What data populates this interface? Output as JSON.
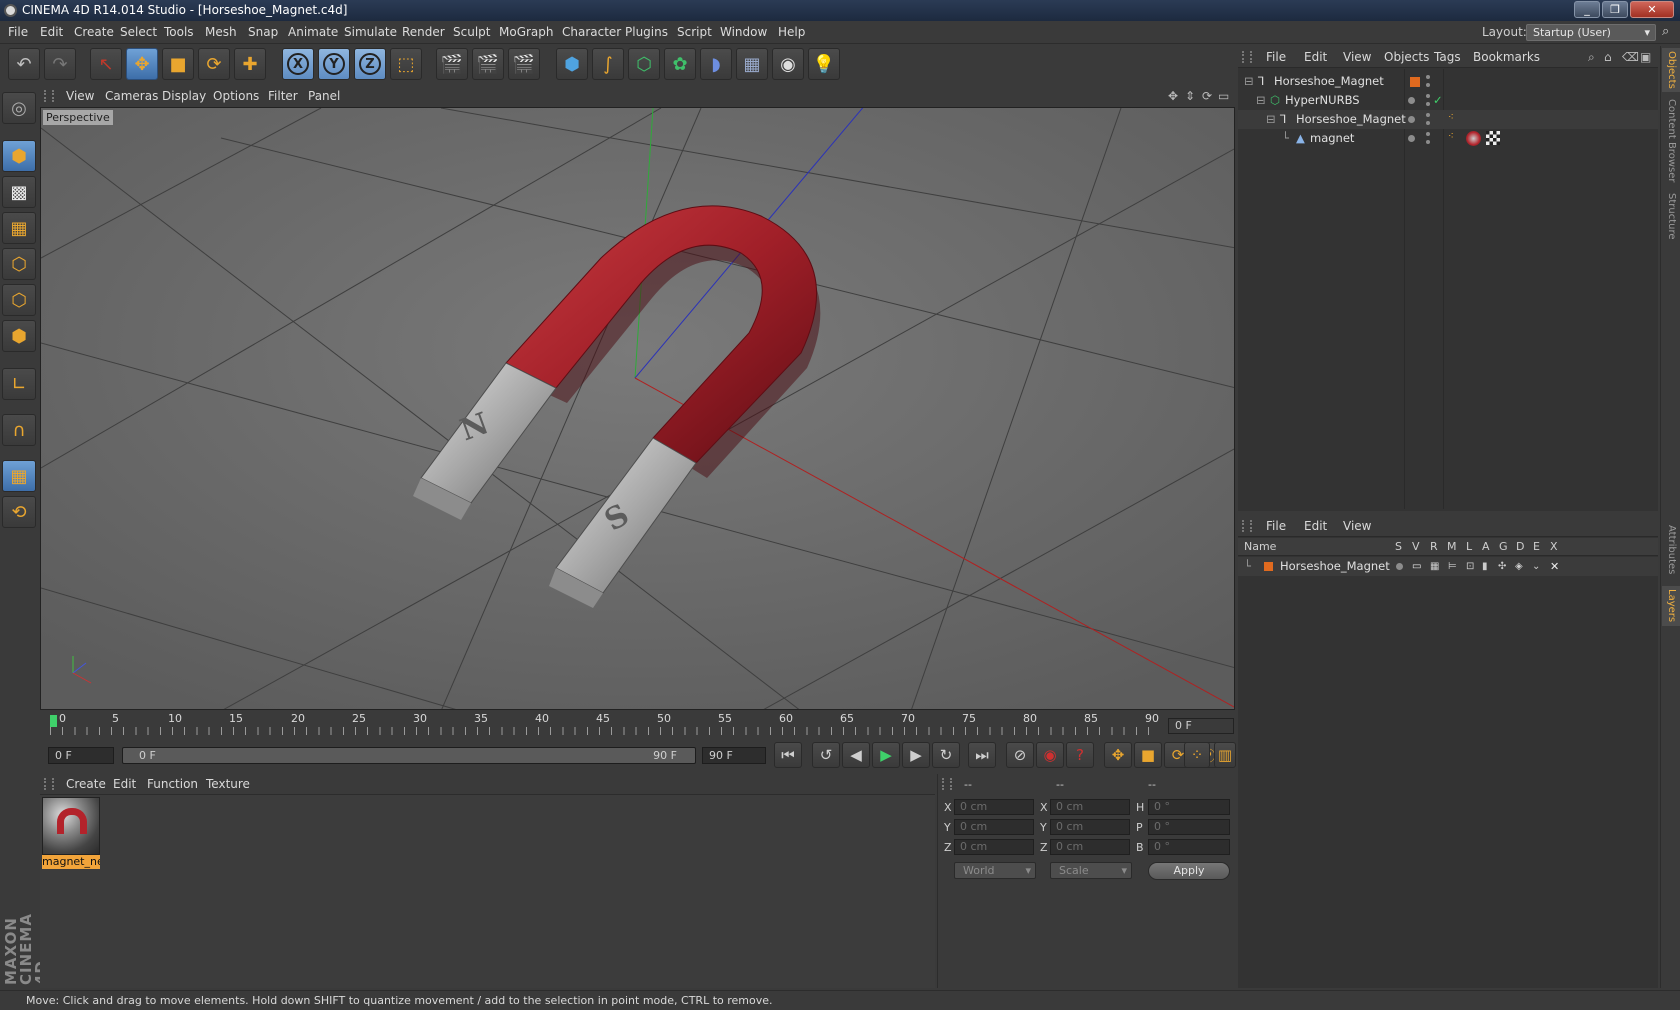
{
  "window": {
    "title": "CINEMA 4D R14.014 Studio - [Horseshoe_Magnet.c4d]",
    "min": "_",
    "max": "❐",
    "close": "✕"
  },
  "menubar": [
    "File",
    "Edit",
    "Create",
    "Select",
    "Tools",
    "Mesh",
    "Snap",
    "Animate",
    "Simulate",
    "Render",
    "Sculpt",
    "MoGraph",
    "Character",
    "Plugins",
    "Script",
    "Window",
    "Help"
  ],
  "layout": {
    "label": "Layout:",
    "value": "Startup (User)"
  },
  "toolbar": {
    "axis_x": "X",
    "axis_y": "Y",
    "axis_z": "Z"
  },
  "viewport": {
    "menu": [
      "View",
      "Cameras",
      "Display",
      "Options",
      "Filter",
      "Panel"
    ],
    "label": "Perspective",
    "magnet_n": "N",
    "magnet_s": "S"
  },
  "timeline": {
    "ticks": [
      "0",
      "5",
      "10",
      "15",
      "20",
      "25",
      "30",
      "35",
      "40",
      "45",
      "50",
      "55",
      "60",
      "65",
      "70",
      "75",
      "80",
      "85",
      "90"
    ],
    "current": "0 F"
  },
  "transport": {
    "start": "0 F",
    "range_start": "0 F",
    "range_end": "90 F",
    "end": "90 F"
  },
  "material_manager": {
    "menu": [
      "Create",
      "Edit",
      "Function",
      "Texture"
    ],
    "material_name": "magnet_ne"
  },
  "coordinates": {
    "header": [
      "--",
      "--",
      "--"
    ],
    "pos": [
      {
        "axis": "X",
        "value": "0 cm"
      },
      {
        "axis": "Y",
        "value": "0 cm"
      },
      {
        "axis": "Z",
        "value": "0 cm"
      }
    ],
    "size": [
      {
        "axis": "X",
        "value": "0 cm"
      },
      {
        "axis": "Y",
        "value": "0 cm"
      },
      {
        "axis": "Z",
        "value": "0 cm"
      }
    ],
    "rot": [
      {
        "axis": "H",
        "value": "0 °"
      },
      {
        "axis": "P",
        "value": "0 °"
      },
      {
        "axis": "B",
        "value": "0 °"
      }
    ],
    "mode": "World",
    "size_mode": "Scale",
    "apply": "Apply"
  },
  "object_manager": {
    "menu": [
      "File",
      "Edit",
      "View",
      "Objects",
      "Tags",
      "Bookmarks"
    ],
    "objects": [
      {
        "name": "Horseshoe_Magnet"
      },
      {
        "name": "HyperNURBS"
      },
      {
        "name": "Horseshoe_Magnet"
      },
      {
        "name": "magnet"
      }
    ]
  },
  "attribute_manager": {
    "menu": [
      "File",
      "Edit",
      "View"
    ],
    "columns": [
      "Name",
      "S",
      "V",
      "R",
      "M",
      "L",
      "A",
      "G",
      "D",
      "E",
      "X"
    ],
    "layer_name": "Horseshoe_Magnet"
  },
  "side_tabs": [
    "Objects",
    "Content Browser",
    "Structure",
    "Attributes",
    "Layers"
  ],
  "status": "Move: Click and drag to move elements. Hold down SHIFT to quantize movement / add to the selection in point mode, CTRL to remove.",
  "colors": {
    "accent": "#f2a43a",
    "active": "#5e8cc2",
    "magnet_red": "#a8202a"
  }
}
